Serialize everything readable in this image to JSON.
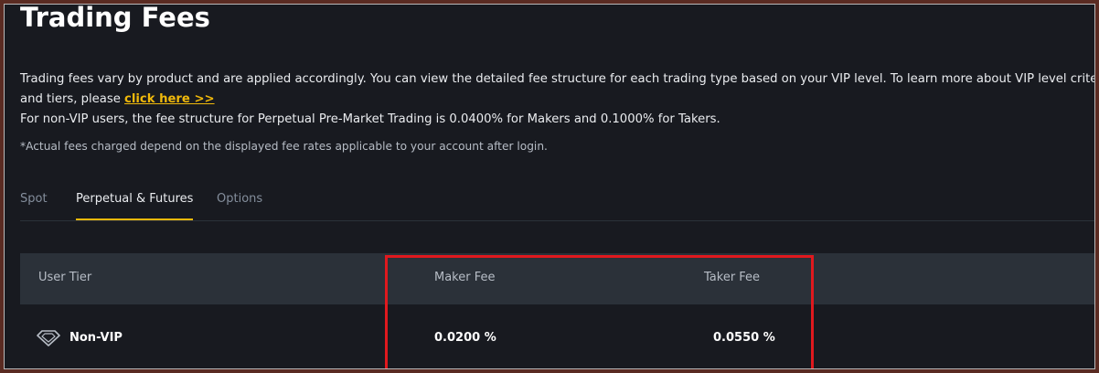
{
  "page": {
    "title": "Trading Fees",
    "description_line1": "Trading fees vary by product and are applied accordingly. You can view the detailed fee structure for each trading type based on your VIP level. To learn more about VIP level criteria",
    "description_line2_prefix": "and tiers, please ",
    "link_text": "click here >>",
    "description_line3": "For non-VIP users, the fee structure for Perpetual Pre-Market Trading is 0.0400% for Makers and 0.1000% for Takers.",
    "note": "*Actual fees charged depend on the displayed fee rates applicable to your account after login."
  },
  "tabs": [
    {
      "label": "Spot",
      "active": false
    },
    {
      "label": "Perpetual & Futures",
      "active": true
    },
    {
      "label": "Options",
      "active": false
    }
  ],
  "table": {
    "headers": {
      "tier": "User Tier",
      "maker": "Maker Fee",
      "taker": "Taker Fee"
    },
    "rows": [
      {
        "tier": "Non-VIP",
        "maker": "0.0200 %",
        "taker": "0.0550 %",
        "icon": "diamond-icon"
      }
    ]
  },
  "colors": {
    "background": "#181a20",
    "accent": "#f0b90b",
    "header_bg": "#2b3139",
    "highlight": "#e0191e"
  }
}
